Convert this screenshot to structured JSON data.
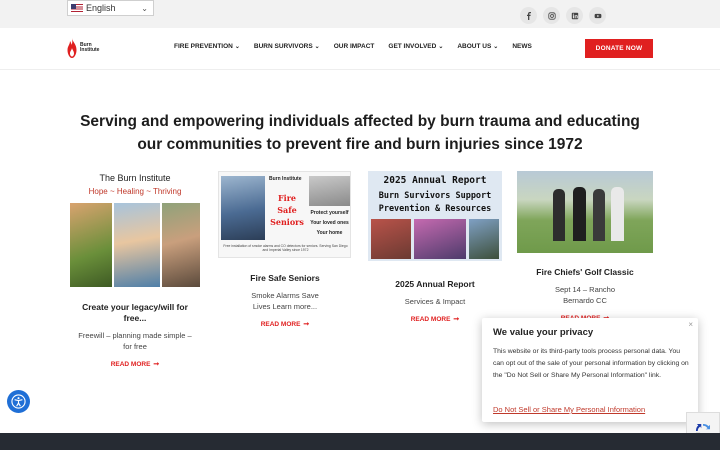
{
  "topbar": {
    "language": "English",
    "social": [
      "facebook-icon",
      "instagram-icon",
      "linkedin-icon",
      "youtube-icon"
    ]
  },
  "header": {
    "logo_text_1": "Burn",
    "logo_text_2": "Institute",
    "nav": [
      {
        "label": "FIRE PREVENTION",
        "dropdown": true
      },
      {
        "label": "BURN SURVIVORS",
        "dropdown": true
      },
      {
        "label": "OUR IMPACT",
        "dropdown": false
      },
      {
        "label": "GET INVOLVED",
        "dropdown": true
      },
      {
        "label": "ABOUT US",
        "dropdown": true
      },
      {
        "label": "NEWS",
        "dropdown": false
      }
    ],
    "donate": "DONATE NOW"
  },
  "hero": {
    "headline": "Serving and empowering individuals affected by burn trauma and educating our communities to prevent fire and burn injuries since 1972"
  },
  "cards": [
    {
      "image_line1": "The Burn Institute",
      "image_line2": "Hope ~ Healing ~ Thriving",
      "title": "Create your legacy/will for free...",
      "desc": "Freewill – planning made simple – for free",
      "more": "READ MORE"
    },
    {
      "image_logo": "Burn Institute",
      "image_title": "Fire Safe Seniors",
      "image_lines": [
        "Protect yourself",
        "Your loved ones",
        "Your home"
      ],
      "image_caption": "Free installation of smoke alarms and CO detectors for seniors. Serving San Diego and Imperial Valley since 1972",
      "title": "Fire Safe Seniors",
      "desc": "Smoke Alarms Save Lives Learn more...",
      "more": "READ MORE"
    },
    {
      "image_line1": "2025 Annual Report",
      "image_line2": "Burn Survivors Support",
      "image_line3": "Prevention & Resources",
      "title": "2025 Annual Report",
      "desc": "Services & Impact",
      "more": "READ MORE"
    },
    {
      "title": "Fire Chiefs' Golf Classic",
      "desc": "Sept 14 – Rancho Bernardo CC",
      "more": "READ MORE"
    }
  ],
  "cookie": {
    "title": "We value your privacy",
    "body": "This website or its third-party tools process personal data. You can opt out of the sale of your personal information by clicking on the \"Do Not Sell or Share My Personal Information\" link.",
    "link": "Do Not Sell or Share My Personal Information",
    "close": "×"
  },
  "colors": {
    "brand_red": "#e02020",
    "a11y_blue": "#1f6fd6",
    "footer": "#262b33"
  }
}
